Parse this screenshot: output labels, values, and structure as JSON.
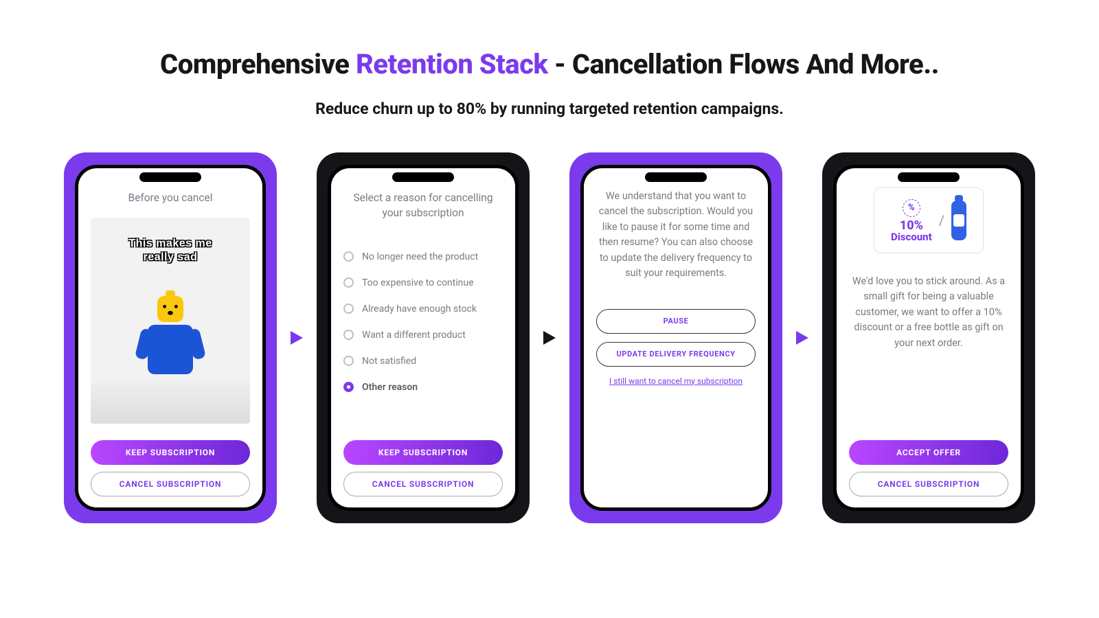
{
  "heading": {
    "pre": "Comprehensive ",
    "accent": "Retention Stack",
    "post": " - Cancellation Flows And More.."
  },
  "subheading": "Reduce churn up to 80% by running targeted retention campaigns.",
  "colors": {
    "purple": "#7C3AED",
    "black": "#141519"
  },
  "card1": {
    "title": "Before you cancel",
    "meme_text": "This makes me\nreally sad",
    "primary": "KEEP SUBSCRIPTION",
    "secondary": "CANCEL SUBSCRIPTION"
  },
  "card2": {
    "title": "Select a reason for cancelling your subscription",
    "options": [
      "No longer need the product",
      "Too expensive to continue",
      "Already have enough stock",
      "Want a different product",
      "Not satisfied",
      "Other reason"
    ],
    "selected_index": 5,
    "primary": "KEEP SUBSCRIPTION",
    "secondary": "CANCEL SUBSCRIPTION"
  },
  "card3": {
    "paragraph": "We understand that you want to cancel the subscription. Would you like to pause it for some time and then resume? You can also choose to update the delivery frequency to suit your requirements.",
    "pause": "PAUSE",
    "update": "UPDATE DELIVERY FREQUENCY",
    "link": "I still want to cancel my subscription"
  },
  "card4": {
    "discount_pct": "10%",
    "discount_label": "Discount",
    "paragraph": "We'd love you to stick around. As a small gift for being a valuable customer, we want to offer a 10% discount or a free bottle as gift on your next order.",
    "primary": "ACCEPT OFFER",
    "secondary": "CANCEL SUBSCRIPTION"
  }
}
